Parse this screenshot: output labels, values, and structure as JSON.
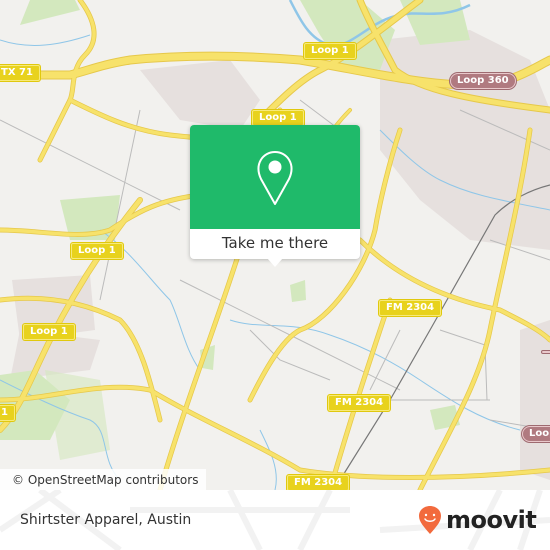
{
  "map": {
    "colors": {
      "land": "#f2f1ee",
      "urban": "#e6e0de",
      "park": "#d3e8be",
      "water": "#8fc6e8",
      "road_major": "#f7e26b",
      "road_major_casing": "#e6c84a",
      "road_minor": "#bbbbbb",
      "railway": "#777777"
    },
    "labels": {
      "shields": [
        {
          "text": "TX 71",
          "style": "yellow"
        },
        {
          "text": "Loop 1",
          "style": "yellow"
        },
        {
          "text": "Loop 1",
          "style": "yellow"
        },
        {
          "text": "Loop 360",
          "style": "maroon"
        },
        {
          "text": "Loop 1",
          "style": "yellow"
        },
        {
          "text": "Loop 1",
          "style": "yellow"
        },
        {
          "text": "1",
          "style": "yellow"
        },
        {
          "text": "FM 2304",
          "style": "yellow"
        },
        {
          "text": "FM 2304",
          "style": "yellow"
        },
        {
          "text": "FM 2304",
          "style": "yellow"
        },
        {
          "text": "",
          "style": "maroon"
        },
        {
          "text": "Loop",
          "style": "maroon"
        }
      ]
    },
    "attribution": "© OpenStreetMap contributors"
  },
  "popup": {
    "icon": "location-pin-icon",
    "action_label": "Take me there",
    "accent_color": "#1fba6a"
  },
  "footer": {
    "place_name": "Shirtster Apparel, Austin",
    "brand": {
      "name": "moovit",
      "logo_icon": "moovit-smiley-pin-icon",
      "logo_color": "#f26a3d"
    }
  }
}
